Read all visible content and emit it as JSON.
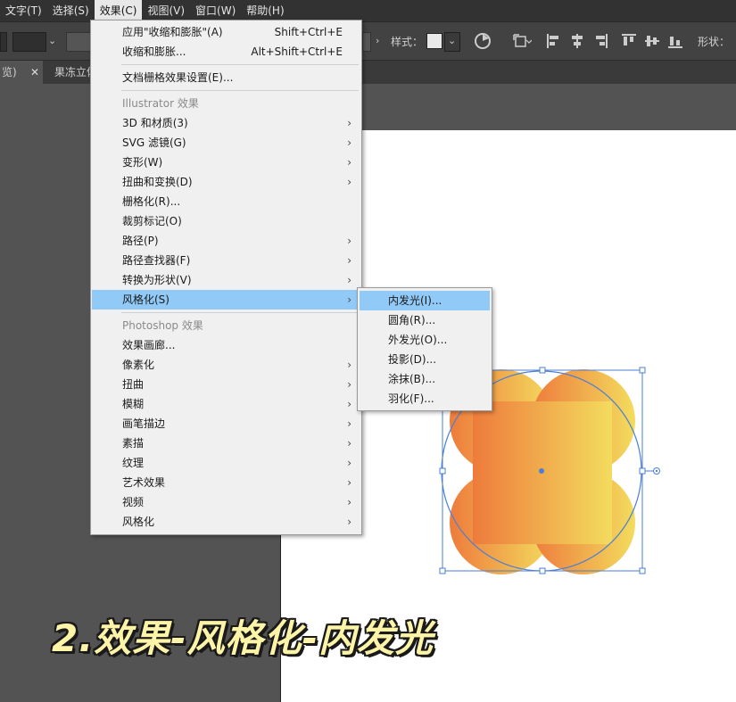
{
  "menubar": {
    "items": [
      {
        "label": "文字(T)"
      },
      {
        "label": "选择(S)"
      },
      {
        "label": "效果(C)",
        "active": true
      },
      {
        "label": "视图(V)"
      },
      {
        "label": "窗口(W)"
      },
      {
        "label": "帮助(H)"
      }
    ]
  },
  "controlbar": {
    "style_label": "样式：",
    "shape_label": "形状："
  },
  "tabs": [
    {
      "label": "览)"
    },
    {
      "label": "果冻立体"
    }
  ],
  "effect_menu": {
    "top_items": [
      {
        "label": "应用\"收缩和膨胀\"(A)",
        "shortcut": "Shift+Ctrl+E"
      },
      {
        "label": "收缩和膨胀...",
        "shortcut": "Alt+Shift+Ctrl+E"
      }
    ],
    "doc_raster": "文档栅格效果设置(E)...",
    "illustrator_header": "Illustrator 效果",
    "illustrator_items": [
      {
        "label": "3D 和材质(3)",
        "submenu": true
      },
      {
        "label": "SVG 滤镜(G)",
        "submenu": true
      },
      {
        "label": "变形(W)",
        "submenu": true
      },
      {
        "label": "扭曲和变换(D)",
        "submenu": true
      },
      {
        "label": "栅格化(R)...",
        "submenu": false
      },
      {
        "label": "裁剪标记(O)",
        "submenu": false
      },
      {
        "label": "路径(P)",
        "submenu": true
      },
      {
        "label": "路径查找器(F)",
        "submenu": true
      },
      {
        "label": "转换为形状(V)",
        "submenu": true
      },
      {
        "label": "风格化(S)",
        "submenu": true,
        "highlighted": true
      }
    ],
    "photoshop_header": "Photoshop 效果",
    "photoshop_items": [
      {
        "label": "效果画廊...",
        "submenu": false
      },
      {
        "label": "像素化",
        "submenu": true
      },
      {
        "label": "扭曲",
        "submenu": true
      },
      {
        "label": "模糊",
        "submenu": true
      },
      {
        "label": "画笔描边",
        "submenu": true
      },
      {
        "label": "素描",
        "submenu": true
      },
      {
        "label": "纹理",
        "submenu": true
      },
      {
        "label": "艺术效果",
        "submenu": true
      },
      {
        "label": "视频",
        "submenu": true
      },
      {
        "label": "风格化",
        "submenu": true
      }
    ]
  },
  "stylize_submenu": {
    "items": [
      {
        "label": "内发光(I)...",
        "highlighted": true
      },
      {
        "label": "圆角(R)..."
      },
      {
        "label": "外发光(O)..."
      },
      {
        "label": "投影(D)..."
      },
      {
        "label": "涂抹(B)..."
      },
      {
        "label": "羽化(F)..."
      }
    ]
  },
  "caption": "2.效果-风格化-内发光",
  "colors": {
    "highlight": "#91c9f7",
    "gradient_start": "#ee7b3c",
    "gradient_end": "#f3dc5e",
    "selection": "#4a7fd6",
    "caption_fill": "#fdf4a8"
  }
}
